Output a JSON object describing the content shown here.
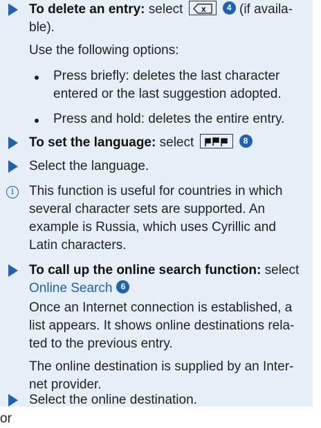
{
  "lines": [
    "To delete an entry:",
    " select",
    "(if availa-",
    "ble).",
    "Use the following options:",
    "Press briefly: deletes the last character",
    "entered or the last suggestion adopted.",
    "Press and hold: deletes the entire entry.",
    "To set the language:",
    " select",
    "Select the language.",
    "This function is useful for countries in which",
    "several character sets are supported. An",
    "example is Russia, which uses Cyrillic and",
    "Latin characters.",
    "To call up the online search function:",
    " select",
    "Online Search",
    "Once an Internet connection is established, a",
    "list appears. It shows online destinations rela-",
    "ted to the previous entry.",
    "The online destination is supplied by an Inter-",
    "net provider.",
    "Select the online destination.",
    "or"
  ],
  "callouts": {
    "delete": "4",
    "language": "8",
    "online": "6"
  },
  "icons": {
    "arrow": "right-triangle-arrow",
    "bullet": "bullet-dot",
    "info": "info-circle",
    "backspace": "backspace-key",
    "flags": "flag-language"
  },
  "symbols": {
    "backspace_x": "x",
    "info_i": "i"
  },
  "colors": {
    "accent": "#1e62b4",
    "band": "#e6eff8",
    "text": "#222222"
  }
}
